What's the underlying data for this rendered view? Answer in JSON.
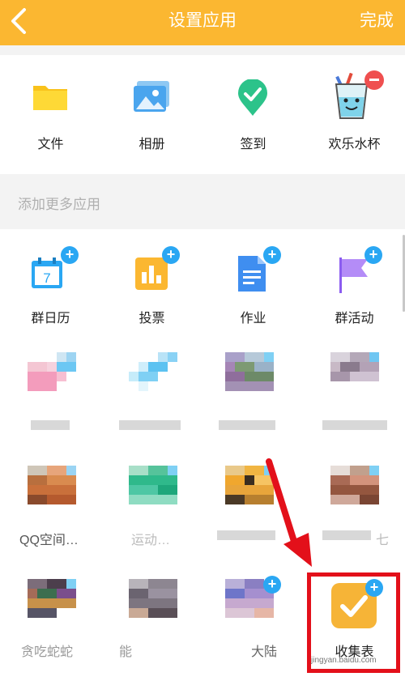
{
  "header": {
    "title": "设置应用",
    "done_label": "完成",
    "back_icon": "chevron-left-icon",
    "bg_color": "#fbb731"
  },
  "current_apps": [
    {
      "label": "文件",
      "icon": "folder-icon"
    },
    {
      "label": "相册",
      "icon": "photo-album-icon"
    },
    {
      "label": "签到",
      "icon": "check-in-icon"
    },
    {
      "label": "欢乐水杯",
      "icon": "water-cup-icon"
    }
  ],
  "more_section": {
    "label": "添加更多应用"
  },
  "more_apps": [
    {
      "label": "群日历",
      "icon": "calendar-icon",
      "day": "7"
    },
    {
      "label": "投票",
      "icon": "vote-chart-icon"
    },
    {
      "label": "作业",
      "icon": "homework-doc-icon"
    },
    {
      "label": "群活动",
      "icon": "flag-icon"
    }
  ],
  "fragments": {
    "qq_space": "QQ空间…",
    "row3_b": "运动…",
    "row3_d": "七",
    "row4_a": "贪吃蛇蛇",
    "row4_b": "能",
    "row4_c": "大陆",
    "row4_d": "收集表"
  },
  "watermark": "jingyan.baidu.com",
  "accent": {
    "plus": "#2aa7f3",
    "remove": "#ef4f4f",
    "highlight": "#e3101a"
  }
}
